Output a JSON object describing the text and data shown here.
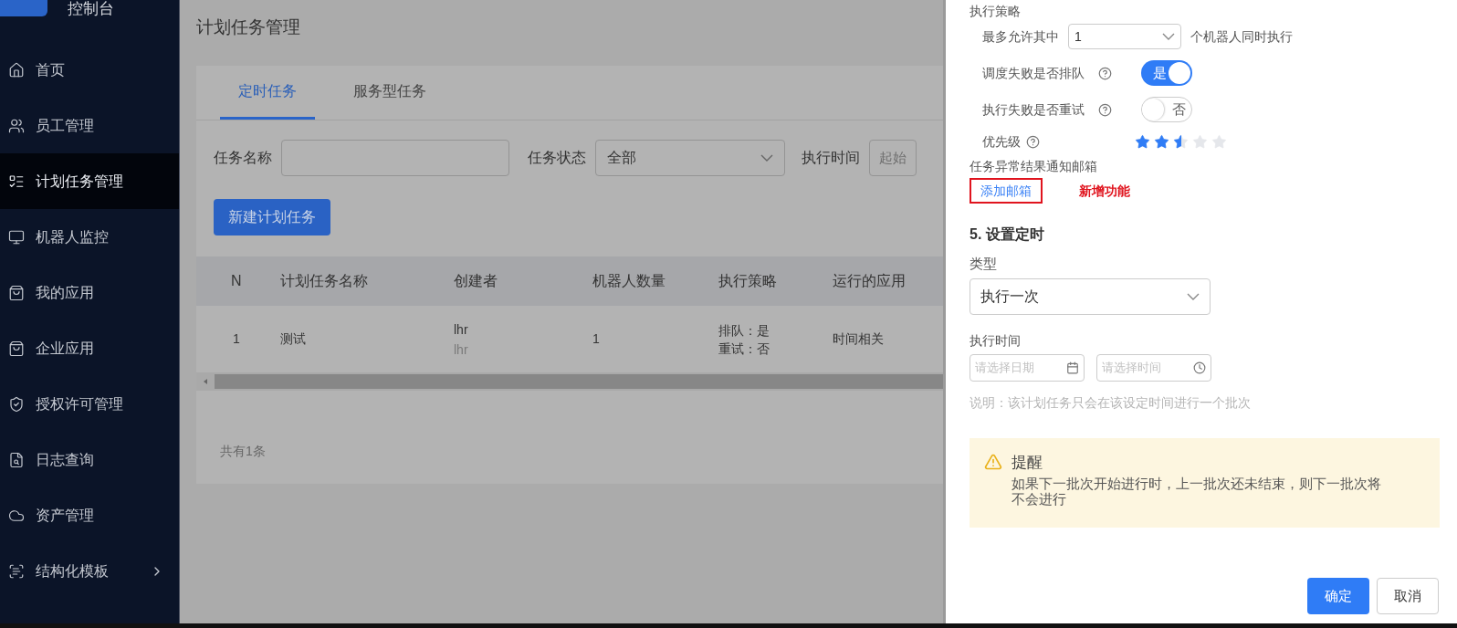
{
  "sidebar": {
    "logo_text": "控制台",
    "items": [
      {
        "label": "首页",
        "selected": false,
        "submenu": false
      },
      {
        "label": "员工管理",
        "selected": false,
        "submenu": false
      },
      {
        "label": "计划任务管理",
        "selected": true,
        "submenu": false
      },
      {
        "label": "机器人监控",
        "selected": false,
        "submenu": false
      },
      {
        "label": "我的应用",
        "selected": false,
        "submenu": false
      },
      {
        "label": "企业应用",
        "selected": false,
        "submenu": false
      },
      {
        "label": "授权许可管理",
        "selected": false,
        "submenu": false
      },
      {
        "label": "日志查询",
        "selected": false,
        "submenu": false
      },
      {
        "label": "资产管理",
        "selected": false,
        "submenu": false
      },
      {
        "label": "结构化模板",
        "selected": false,
        "submenu": true
      }
    ]
  },
  "page": {
    "title": "计划任务管理",
    "tabs": [
      {
        "label": "定时任务",
        "selected": true
      },
      {
        "label": "服务型任务",
        "selected": false
      }
    ],
    "filters": {
      "name_label": "任务名称",
      "status_label": "任务状态",
      "status_value": "全部",
      "time_label": "执行时间",
      "time_placeholder": "起始"
    },
    "new_button": "新建计划任务",
    "table": {
      "columns": [
        "N",
        "计划任务名称",
        "创建者",
        "机器人数量",
        "执行策略",
        "运行的应用"
      ],
      "rows": [
        {
          "n": "1",
          "name": "测试",
          "creator": "lhr",
          "creator_sub": "lhr",
          "robots": "1",
          "strategy": [
            "排队：是",
            "重试：否"
          ],
          "app": "时间相关"
        }
      ]
    },
    "total": "共有1条"
  },
  "drawer": {
    "strategy_title": "执行策略",
    "max_prefix": "最多允许其中",
    "max_value": "1",
    "max_suffix": "个机器人同时执行",
    "switches": [
      {
        "label": "调度失败是否排队",
        "on": true,
        "on_text": "是"
      },
      {
        "label": "执行失败是否重试",
        "on": false,
        "off_text": "否"
      }
    ],
    "priority": {
      "label": "优先级",
      "stars": 2.5
    },
    "email_label": "任务异常结果通知邮箱",
    "add_email": "添加邮箱",
    "new_feature_note": "新增功能",
    "section_title": "5. 设置定时",
    "type_label": "类型",
    "type_value": "执行一次",
    "time_label": "执行时间",
    "date_placeholder": "请选择日期",
    "time_placeholder": "请选择时间",
    "note": "说明：该计划任务只会在该设定时间进行一个批次",
    "alert": {
      "title": "提醒",
      "text": "如果下一批次开始进行时，上一批次还未结束，则下一批次将不会进行"
    },
    "buttons": [
      {
        "label": "确定",
        "kind": "primary"
      },
      {
        "label": "取消",
        "kind": "default"
      }
    ]
  }
}
